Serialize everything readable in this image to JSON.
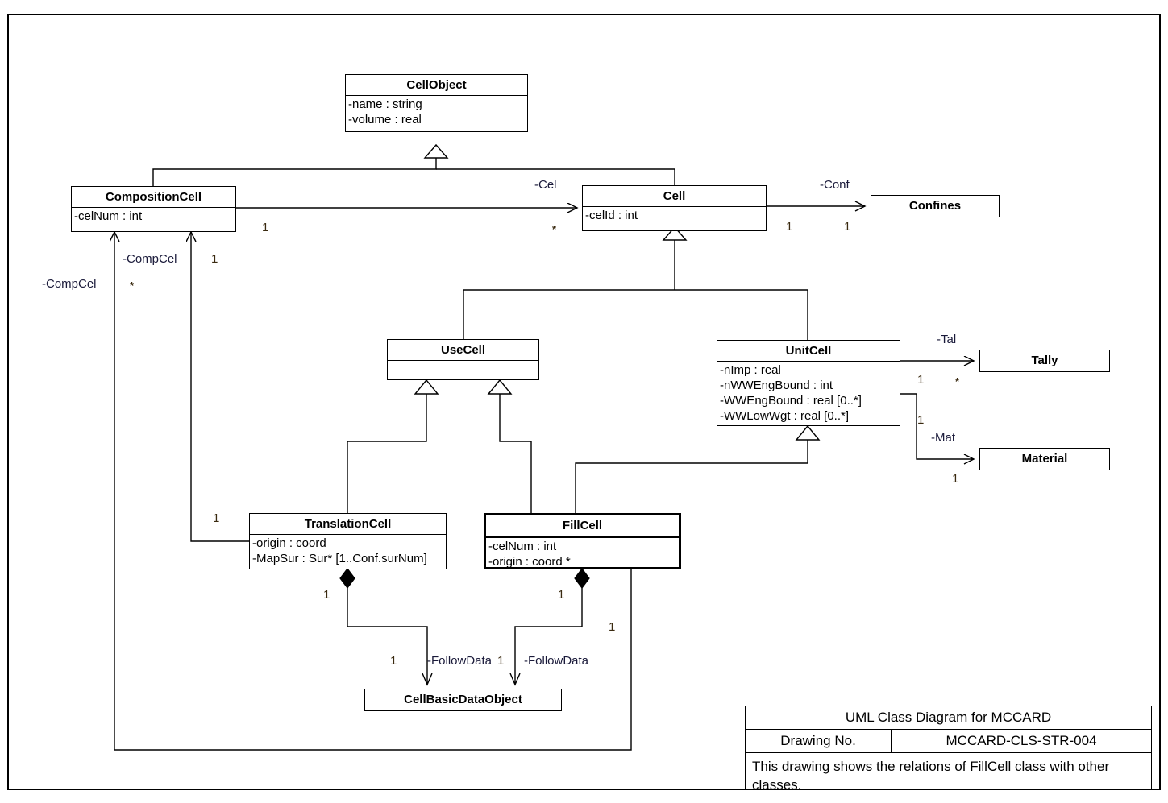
{
  "diagram": {
    "title": "UML Class Diagram for MCCARD",
    "frame_border_color": "#000000"
  },
  "classes": {
    "cellobject": {
      "name": "CellObject",
      "attributes": [
        "-name : string",
        "-volume : real"
      ]
    },
    "compositioncell": {
      "name": "CompositionCell",
      "attributes": [
        "-celNum : int"
      ]
    },
    "cell": {
      "name": "Cell",
      "attributes": [
        "-celId : int"
      ]
    },
    "confines": {
      "name": "Confines",
      "attributes": []
    },
    "usecell": {
      "name": "UseCell",
      "attributes": []
    },
    "unitcell": {
      "name": "UnitCell",
      "attributes": [
        "-nImp : real",
        "-nWWEngBound : int",
        "-WWEngBound : real [0..*]",
        "-WWLowWgt : real [0..*]"
      ]
    },
    "tally": {
      "name": "Tally",
      "attributes": []
    },
    "material": {
      "name": "Material",
      "attributes": []
    },
    "translationcell": {
      "name": "TranslationCell",
      "attributes": [
        "-origin : coord",
        "-MapSur : Sur* [1..Conf.surNum]"
      ]
    },
    "fillcell": {
      "name": "FillCell",
      "attributes": [
        "-celNum : int",
        "-origin : coord *"
      ]
    },
    "cellbasicdataobject": {
      "name": "CellBasicDataObject",
      "attributes": []
    }
  },
  "labels": {
    "cel_role": "-Cel",
    "cel_mult_src": "1",
    "cel_mult_dst": "*",
    "conf_role": "-Conf",
    "conf_mult_src": "1",
    "conf_mult_dst": "1",
    "compcel_role_left": "-CompCel",
    "compcel_role_mid": "-CompCel",
    "compcel_mult_star": "*",
    "compcel_mult_one_mid": "1",
    "compcel_mult_one_trans": "1",
    "compcel_mult_one_fill": "1",
    "tal_role": "-Tal",
    "tal_mult_src": "1",
    "tal_mult_dst": "*",
    "mat_role": "-Mat",
    "mat_mult_src": "1",
    "mat_mult_dst": "1",
    "followdata_role_left": "-FollowData",
    "followdata_role_right": "-FollowData",
    "trans_agg_mult": "1",
    "fill_agg_mult": "1",
    "cbdo_mult_left": "1",
    "cbdo_mult_right": "1"
  },
  "title_block": {
    "title": "UML Class Diagram for MCCARD",
    "drawing_no_label": "Drawing No.",
    "drawing_no_value": "MCCARD-CLS-STR-004",
    "description": "This drawing shows the relations of FillCell class with other classes."
  }
}
